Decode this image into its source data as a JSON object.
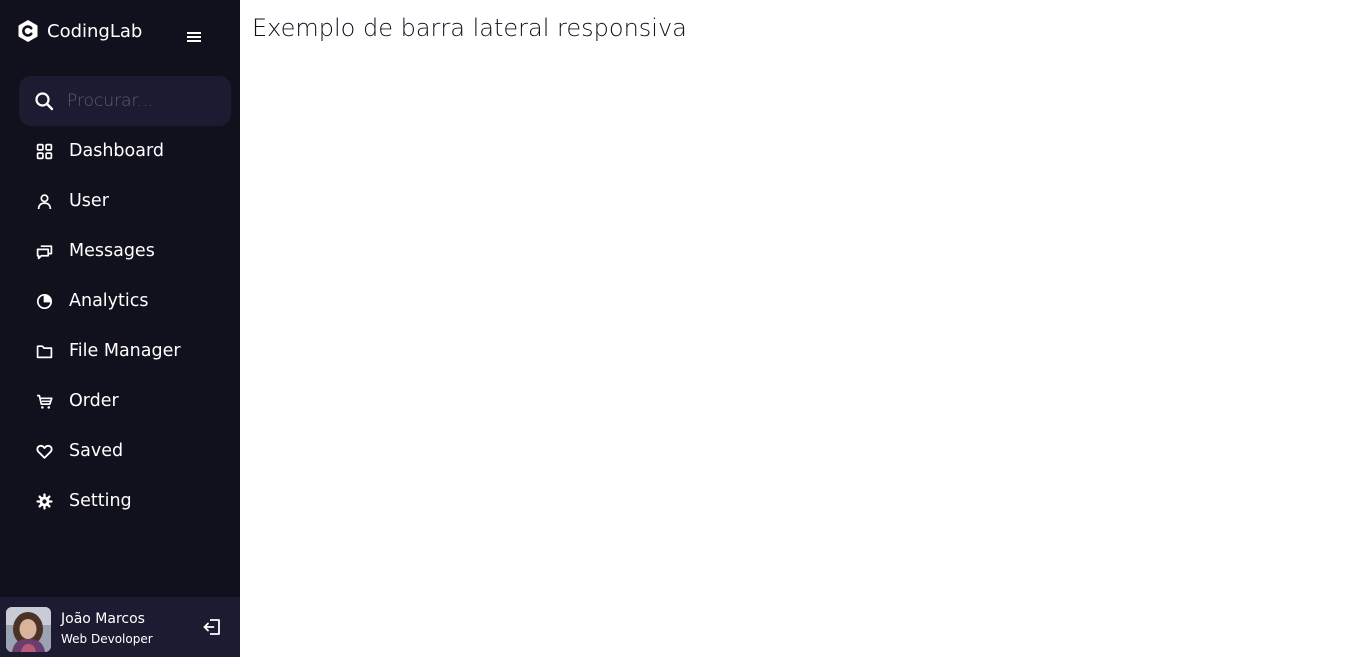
{
  "sidebar": {
    "logo": {
      "name": "CodingLab",
      "icon": "c-logo-icon"
    },
    "menu_icon": "menu-icon",
    "search": {
      "placeholder": "Procurar...",
      "value": "",
      "icon": "search-icon"
    },
    "items": [
      {
        "label": "Dashboard",
        "icon": "grid-icon"
      },
      {
        "label": "User",
        "icon": "user-icon"
      },
      {
        "label": "Messages",
        "icon": "chat-icon"
      },
      {
        "label": "Analytics",
        "icon": "pie-chart-icon"
      },
      {
        "label": "File Manager",
        "icon": "folder-icon"
      },
      {
        "label": "Order",
        "icon": "cart-icon"
      },
      {
        "label": "Saved",
        "icon": "heart-icon"
      },
      {
        "label": "Setting",
        "icon": "gear-icon"
      }
    ],
    "profile": {
      "name": "João Marcos",
      "job": "Web Devoloper",
      "logout_icon": "logout-icon"
    }
  },
  "main": {
    "title": "Exemplo de barra lateral responsiva"
  },
  "colors": {
    "sidebar_bg": "#11101d",
    "panel_bg": "#1d1b31",
    "text": "#ffffff",
    "placeholder": "#5e5c7a",
    "main_bg": "#ffffff",
    "title_text": "#11101d"
  }
}
